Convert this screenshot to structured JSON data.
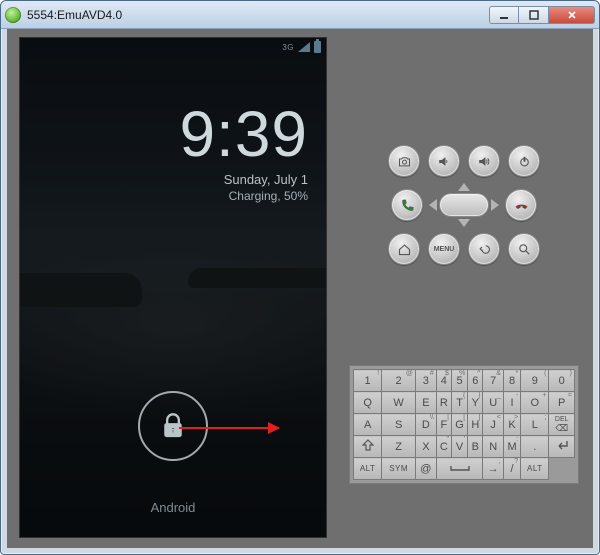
{
  "window": {
    "title": "5554:EmuAVD4.0"
  },
  "phone": {
    "statusbar": {
      "network_label": "3G"
    },
    "clock": "9:39",
    "date": "Sunday, July 1",
    "charging": "Charging, 50%",
    "brand": "Android"
  },
  "controls": {
    "menu_label": "MENU"
  },
  "keyboard": {
    "rows": [
      [
        {
          "main": "1",
          "sup": "!"
        },
        {
          "main": "2",
          "sup": "@"
        },
        {
          "main": "3",
          "sup": "#"
        },
        {
          "main": "4",
          "sup": "$"
        },
        {
          "main": "5",
          "sup": "%"
        },
        {
          "main": "6",
          "sup": "^"
        },
        {
          "main": "7",
          "sup": "&"
        },
        {
          "main": "8",
          "sup": "*"
        },
        {
          "main": "9",
          "sup": "("
        },
        {
          "main": "0",
          "sup": ")"
        }
      ],
      [
        {
          "main": "Q"
        },
        {
          "main": "W"
        },
        {
          "main": "E",
          "sup": "´"
        },
        {
          "main": "R"
        },
        {
          "main": "T",
          "sup": "{"
        },
        {
          "main": "Y",
          "sup": "}"
        },
        {
          "main": "U",
          "sup": "_"
        },
        {
          "main": "I",
          "sup": "-"
        },
        {
          "main": "O",
          "sup": "+"
        },
        {
          "main": "P",
          "sup": "="
        }
      ],
      [
        {
          "main": "A"
        },
        {
          "main": "S",
          "sup": "`"
        },
        {
          "main": "D",
          "sup": "\\\\"
        },
        {
          "main": "F",
          "sup": "|"
        },
        {
          "main": "G",
          "sup": "["
        },
        {
          "main": "H",
          "sup": "]"
        },
        {
          "main": "J",
          "sup": "<"
        },
        {
          "main": "K",
          "sup": ">"
        },
        {
          "main": "L",
          "sup": ";"
        },
        {
          "main": "DEL",
          "sup": ""
        }
      ],
      [
        {
          "main": "⇧"
        },
        {
          "main": "Z"
        },
        {
          "main": "X"
        },
        {
          "main": "C",
          "sup": "\""
        },
        {
          "main": "V",
          "sup": "'"
        },
        {
          "main": "B"
        },
        {
          "main": "N"
        },
        {
          "main": "M",
          "sup": ":"
        },
        {
          "main": "."
        },
        {
          "main": "↵"
        }
      ],
      [
        {
          "main": "ALT",
          "alt": true
        },
        {
          "main": "SYM",
          "alt": true
        },
        {
          "main": "@"
        },
        {
          "main": "⎵",
          "span": 3
        },
        {
          "main": "→",
          "sup": ","
        },
        {
          "main": "/",
          "sup": "?"
        },
        {
          "main": "ALT",
          "alt": true
        }
      ]
    ]
  }
}
